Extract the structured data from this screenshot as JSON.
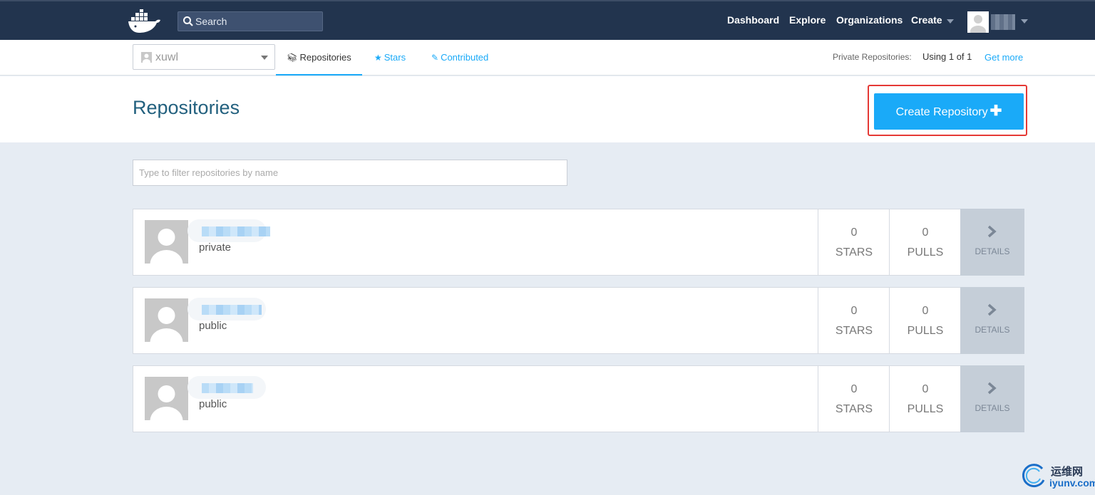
{
  "topnav": {
    "logo": "docker-whale-logo",
    "search_placeholder": "Search",
    "links": [
      "Dashboard",
      "Explore",
      "Organizations",
      "Create"
    ]
  },
  "subnav": {
    "org_name": "xuwl",
    "tabs": [
      "Repositories",
      "Stars",
      "Contributed"
    ],
    "private_label": "Private Repositories:",
    "private_usage": "Using 1 of 1",
    "get_more": "Get more"
  },
  "header": {
    "title": "Repositories",
    "create_label": "Create Repository"
  },
  "filter": {
    "placeholder": "Type to filter repositories by name"
  },
  "repos": [
    {
      "visibility": "private",
      "stars": "0",
      "stars_label": "STARS",
      "pulls": "0",
      "pulls_label": "PULLS",
      "details_label": "DETAILS"
    },
    {
      "visibility": "public",
      "stars": "0",
      "stars_label": "STARS",
      "pulls": "0",
      "pulls_label": "PULLS",
      "details_label": "DETAILS"
    },
    {
      "visibility": "public",
      "stars": "0",
      "stars_label": "STARS",
      "pulls": "0",
      "pulls_label": "PULLS",
      "details_label": "DETAILS"
    }
  ],
  "watermark": {
    "cn": "运维网",
    "en": "iyunv.com"
  },
  "colors": {
    "navbar": "#22344e",
    "accent": "#1aaaf8",
    "highlight": "#e53935",
    "page_bg": "#e6ecf3"
  }
}
